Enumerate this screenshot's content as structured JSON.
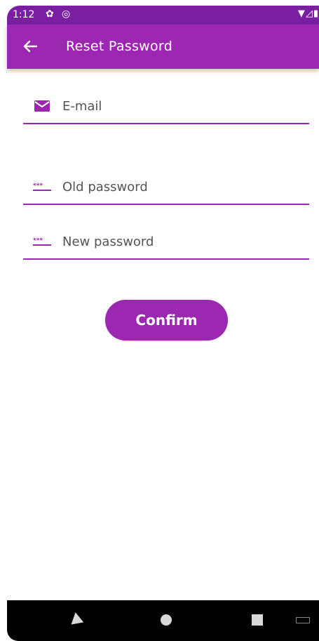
{
  "status_bar": {
    "time": "1:12",
    "icons": [
      "gear-icon",
      "sync-icon",
      "wifi-icon",
      "signal-icon",
      "battery-icon"
    ]
  },
  "app_bar": {
    "title": "Reset Password",
    "back_icon": "arrow-back-icon"
  },
  "form": {
    "email": {
      "placeholder": "E-mail",
      "value": "",
      "icon": "mail-icon"
    },
    "old_password": {
      "placeholder": "Old password",
      "value": "",
      "icon": "password-icon"
    },
    "new_password": {
      "placeholder": "New password",
      "value": "",
      "icon": "password-icon"
    },
    "confirm_label": "Confirm"
  },
  "nav_bar": {
    "buttons": [
      "back-triangle-icon",
      "home-circle-icon",
      "recents-square-icon",
      "keyboard-icon"
    ]
  },
  "colors": {
    "primary": "#9c27b0",
    "primary_dark": "#7b1fa2",
    "on_primary": "#ffffff"
  }
}
